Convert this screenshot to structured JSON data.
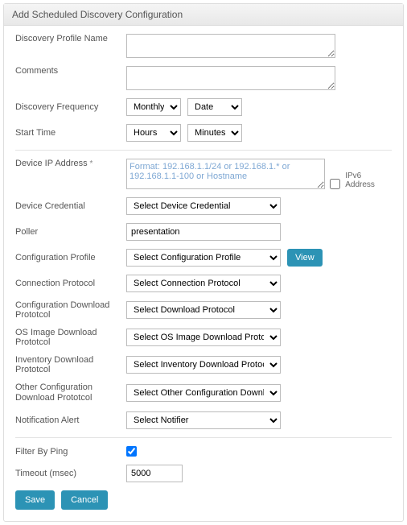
{
  "header": {
    "title": "Add Scheduled Discovery Configuration"
  },
  "profileName": {
    "label": "Discovery Profile Name",
    "value": ""
  },
  "comments": {
    "label": "Comments",
    "value": ""
  },
  "frequency": {
    "label": "Discovery Frequency",
    "val1": "Monthly",
    "val2": "Date"
  },
  "startTime": {
    "label": "Start Time",
    "val1": "Hours",
    "val2": "Minutes"
  },
  "ip": {
    "label": "Device IP Address",
    "placeholder": "Format: 192.168.1.1/24 or 192.168.1.* or 192.168.1.1-100 or Hostname",
    "ipv6Label": "IPv6 Address",
    "ipv6Checked": false
  },
  "credential": {
    "label": "Device Credential",
    "value": "Select Device Credential"
  },
  "poller": {
    "label": "Poller",
    "value": "presentation"
  },
  "configProfile": {
    "label": "Configuration Profile",
    "value": "Select Configuration Profile",
    "viewLabel": "View"
  },
  "connProto": {
    "label": "Connection Protocol",
    "value": "Select Connection Protocol"
  },
  "cfgDlProto": {
    "label": "Configuration Download Prototcol",
    "value": "Select Download Protocol"
  },
  "osDlProto": {
    "label": "OS Image Download Prototcol",
    "value": "Select OS Image Download Protocol"
  },
  "invDlProto": {
    "label": "Inventory Download Prototcol",
    "value": "Select Inventory Download Protocol"
  },
  "otherDlProto": {
    "label": "Other Configuration Download Prototcol",
    "value": "Select Other Configuration Download Pr"
  },
  "notifier": {
    "label": "Notification Alert",
    "value": "Select Notifier"
  },
  "filterPing": {
    "label": "Filter By Ping",
    "checked": true
  },
  "timeout": {
    "label": "Timeout (msec)",
    "value": "5000"
  },
  "buttons": {
    "save": "Save",
    "cancel": "Cancel"
  }
}
